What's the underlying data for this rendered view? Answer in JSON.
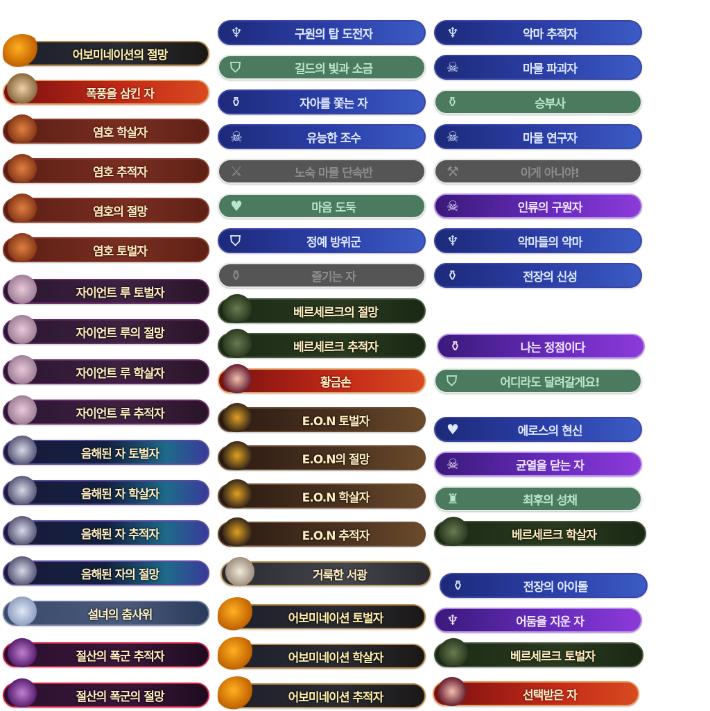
{
  "colors": {
    "blue": "#2b3fa8",
    "green": "#4c7a5e",
    "gray": "#555555",
    "purple": "#6a2cc0",
    "text_gold": "#ffeec0"
  },
  "columns": [
    {
      "badges": [
        {
          "label": "어보미네이션의 절망",
          "style": "p-abom",
          "portrait": "abom"
        },
        {
          "label": "폭풍을 삼킨 자",
          "style": "p-red",
          "portrait": "red"
        },
        {
          "label": "염호 학살자",
          "style": "p-tiger",
          "portrait": "tiger"
        },
        {
          "label": "염호 추적자",
          "style": "p-tiger",
          "portrait": "tiger"
        },
        {
          "label": "염호의 절망",
          "style": "p-tiger",
          "portrait": "tiger"
        },
        {
          "label": "염호 토벌자",
          "style": "p-tiger",
          "portrait": "tiger"
        },
        {
          "label": "자이언트 루 토벌자",
          "style": "p-lu",
          "portrait": "lu"
        },
        {
          "label": "자이언트 루의 절망",
          "style": "p-lu",
          "portrait": "lu"
        },
        {
          "label": "자이언트 루 학살자",
          "style": "p-lu",
          "portrait": "lu"
        },
        {
          "label": "자이언트 루 추적자",
          "style": "p-lu",
          "portrait": "lu"
        },
        {
          "label": "음해된 자 토벌자",
          "style": "p-dark",
          "portrait": "dark"
        },
        {
          "label": "음해된 자 학살자",
          "style": "p-dark",
          "portrait": "dark"
        },
        {
          "label": "음해된 자 추적자",
          "style": "p-dark",
          "portrait": "dark"
        },
        {
          "label": "음해된 자의 절망",
          "style": "p-dark",
          "portrait": "dark"
        },
        {
          "label": "설녀의 춤사위",
          "style": "p-snow",
          "portrait": "snow"
        },
        {
          "label": "절산의 폭군 추적자",
          "style": "p-tyrant",
          "portrait": "tyrant"
        },
        {
          "label": "절산의 폭군의 절망",
          "style": "p-tyrant",
          "portrait": "tyrant"
        }
      ]
    },
    {
      "badges": [
        {
          "label": "구원의 탑 도전자",
          "style": "blue",
          "icon": "demon-icon",
          "glyph": "♆"
        },
        {
          "label": "길드의 빛과 소금",
          "style": "green",
          "icon": "banner-icon",
          "glyph": "⛉"
        },
        {
          "label": "자아를 쫓는 자",
          "style": "blue",
          "icon": "trophy-icon",
          "glyph": "⚱"
        },
        {
          "label": "유능한 조수",
          "style": "blue",
          "icon": "skull-icon",
          "glyph": "☠"
        },
        {
          "label": "노숙 마물 단속반",
          "style": "gray",
          "icon": "crossed-swords-icon",
          "glyph": "⚔"
        },
        {
          "label": "마음 도둑",
          "style": "green",
          "icon": "heart-icon",
          "glyph": "♥"
        },
        {
          "label": "정예 방위군",
          "style": "blue",
          "icon": "banner-icon",
          "glyph": "⛉"
        },
        {
          "label": "즐기는 자",
          "style": "gray",
          "icon": "trophy-icon",
          "glyph": "⚱"
        },
        {
          "label": "베르세르크의 절망",
          "style": "p-bers",
          "portrait": "bers"
        },
        {
          "label": "베르세르크 추적자",
          "style": "p-bers",
          "portrait": "bers"
        },
        {
          "label": "황금손",
          "style": "p-red",
          "portrait": "redgirl"
        },
        {
          "label": "E.O.N 토벌자",
          "style": "p-eon",
          "portrait": "eon"
        },
        {
          "label": "E.O.N의 절망",
          "style": "p-eon",
          "portrait": "eon"
        },
        {
          "label": "E.O.N 학살자",
          "style": "p-eon",
          "portrait": "eon"
        },
        {
          "label": "E.O.N 추적자",
          "style": "p-eon",
          "portrait": "eon"
        },
        {
          "label": "거룩한 서광",
          "style": "p-holy",
          "portrait": "holy"
        },
        {
          "label": "어보미네이션 토벌자",
          "style": "p-abom",
          "portrait": "abom"
        },
        {
          "label": "어보미네이션 학살자",
          "style": "p-abom",
          "portrait": "abom"
        },
        {
          "label": "어보미네이션 추적자",
          "style": "p-abom",
          "portrait": "abom"
        }
      ]
    },
    {
      "badges": [
        {
          "label": "악마 추적자",
          "style": "blue",
          "icon": "demon-icon",
          "glyph": "♆"
        },
        {
          "label": "마물 파괴자",
          "style": "blue",
          "icon": "skull-icon",
          "glyph": "☠"
        },
        {
          "label": "승부사",
          "style": "green",
          "icon": "trophy-icon",
          "glyph": "⚱"
        },
        {
          "label": "마물 연구자",
          "style": "blue",
          "icon": "skull-icon",
          "glyph": "☠"
        },
        {
          "label": "이게 아니야!",
          "style": "gray",
          "icon": "hammer-icon",
          "glyph": "⚒"
        },
        {
          "label": "인류의 구원자",
          "style": "purple",
          "icon": "skull-icon",
          "glyph": "☠"
        },
        {
          "label": "악마들의 악마",
          "style": "blue",
          "icon": "demon-icon",
          "glyph": "♆"
        },
        {
          "label": "전장의 신성",
          "style": "blue",
          "icon": "trophy-icon",
          "glyph": "⚱"
        },
        {
          "label": "나는 정점이다",
          "style": "purple",
          "icon": "trophy-icon",
          "glyph": "⚱"
        },
        {
          "label": "어디라도 달려갈게요!",
          "style": "green",
          "icon": "banner-icon",
          "glyph": "⛉"
        },
        {
          "label": "에로스의 현신",
          "style": "blue",
          "icon": "heart-icon",
          "glyph": "♥"
        },
        {
          "label": "균열을 닫는 자",
          "style": "purple",
          "icon": "skull-icon",
          "glyph": "☠"
        },
        {
          "label": "최후의 성채",
          "style": "green",
          "icon": "fortress-icon",
          "glyph": "♜"
        },
        {
          "label": "베르세르크 학살자",
          "style": "p-bers",
          "portrait": "bers"
        },
        {
          "label": "전장의 아이돌",
          "style": "blue",
          "icon": "trophy-icon",
          "glyph": "⚱"
        },
        {
          "label": "어둠을 지운 자",
          "style": "purple",
          "icon": "demon-icon",
          "glyph": "♆"
        },
        {
          "label": "베르세르크 토벌자",
          "style": "p-bers",
          "portrait": "bers"
        },
        {
          "label": "선택받은 자",
          "style": "p-red",
          "portrait": "redgirl"
        }
      ]
    }
  ]
}
